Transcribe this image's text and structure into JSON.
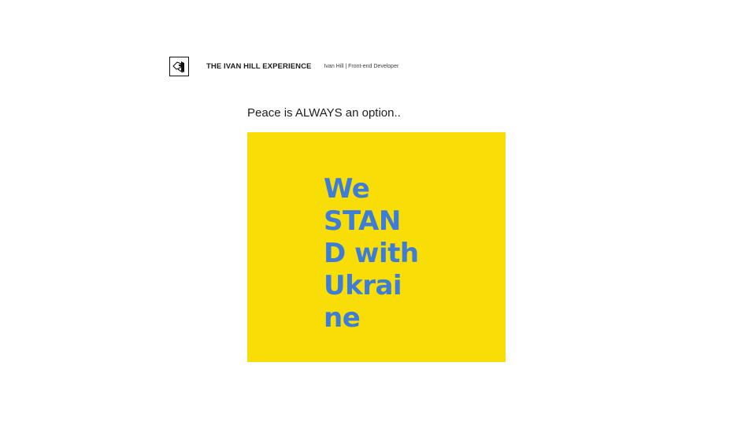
{
  "header": {
    "logo_icon": "house-door-logo-icon",
    "site_title": "THE IVAN HILL EXPERIENCE",
    "tagline": "Ivan Hill | Front-end Developer"
  },
  "post": {
    "text": "Peace is ALWAYS an option..",
    "banner": {
      "background_color": "#f9dd07",
      "text_color": "#3b7dd8",
      "lines": [
        "We",
        "STAN",
        "D with",
        "Ukrai",
        "ne"
      ]
    }
  }
}
